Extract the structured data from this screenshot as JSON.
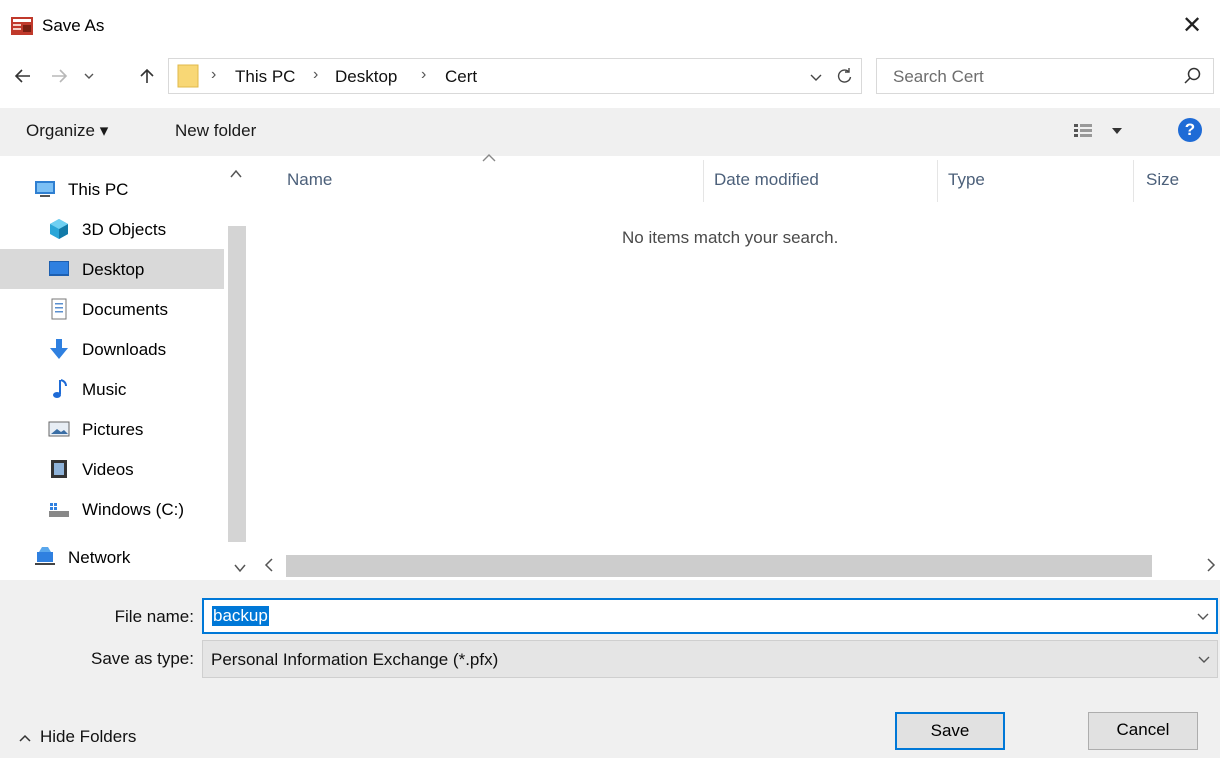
{
  "window": {
    "title": "Save As",
    "close_symbol": "✕"
  },
  "nav": {
    "back_icon": "arrow-left-icon",
    "forward_icon": "arrow-right-icon",
    "recent_icon": "chevron-down-icon",
    "up_icon": "arrow-up-icon",
    "breadcrumbs": [
      "This PC",
      "Desktop",
      "Cert"
    ],
    "breadcrumb_separator": "›"
  },
  "search": {
    "placeholder": "Search Cert"
  },
  "toolbar": {
    "organize_label": "Organize ▾",
    "new_folder_label": "New folder",
    "view_icon": "view-options-icon",
    "help_label": "?"
  },
  "sidebar": {
    "items": [
      {
        "label": "This PC",
        "icon": "computer-icon"
      },
      {
        "label": "3D Objects",
        "icon": "cube-icon"
      },
      {
        "label": "Desktop",
        "icon": "desktop-icon",
        "selected": true
      },
      {
        "label": "Documents",
        "icon": "document-icon"
      },
      {
        "label": "Downloads",
        "icon": "download-icon"
      },
      {
        "label": "Music",
        "icon": "music-note-icon"
      },
      {
        "label": "Pictures",
        "icon": "picture-icon"
      },
      {
        "label": "Videos",
        "icon": "film-icon"
      },
      {
        "label": "Windows  (C:)",
        "icon": "drive-icon"
      },
      {
        "label": "Network",
        "icon": "network-icon"
      }
    ]
  },
  "filelist": {
    "columns": [
      "Name",
      "Date modified",
      "Type",
      "Size"
    ],
    "empty_message": "No items match your search."
  },
  "form": {
    "file_name_label": "File name:",
    "file_name_value": "backup",
    "save_type_label": "Save as type:",
    "save_type_value": "Personal Information Exchange (*.pfx)"
  },
  "footer": {
    "hide_folders_label": "Hide Folders",
    "save_label": "Save",
    "cancel_label": "Cancel"
  },
  "colors": {
    "accent": "#0078d7",
    "selected_bg": "#d9d9d9",
    "panel_bg": "#f0f0f0",
    "column_header": "#4c607a"
  }
}
